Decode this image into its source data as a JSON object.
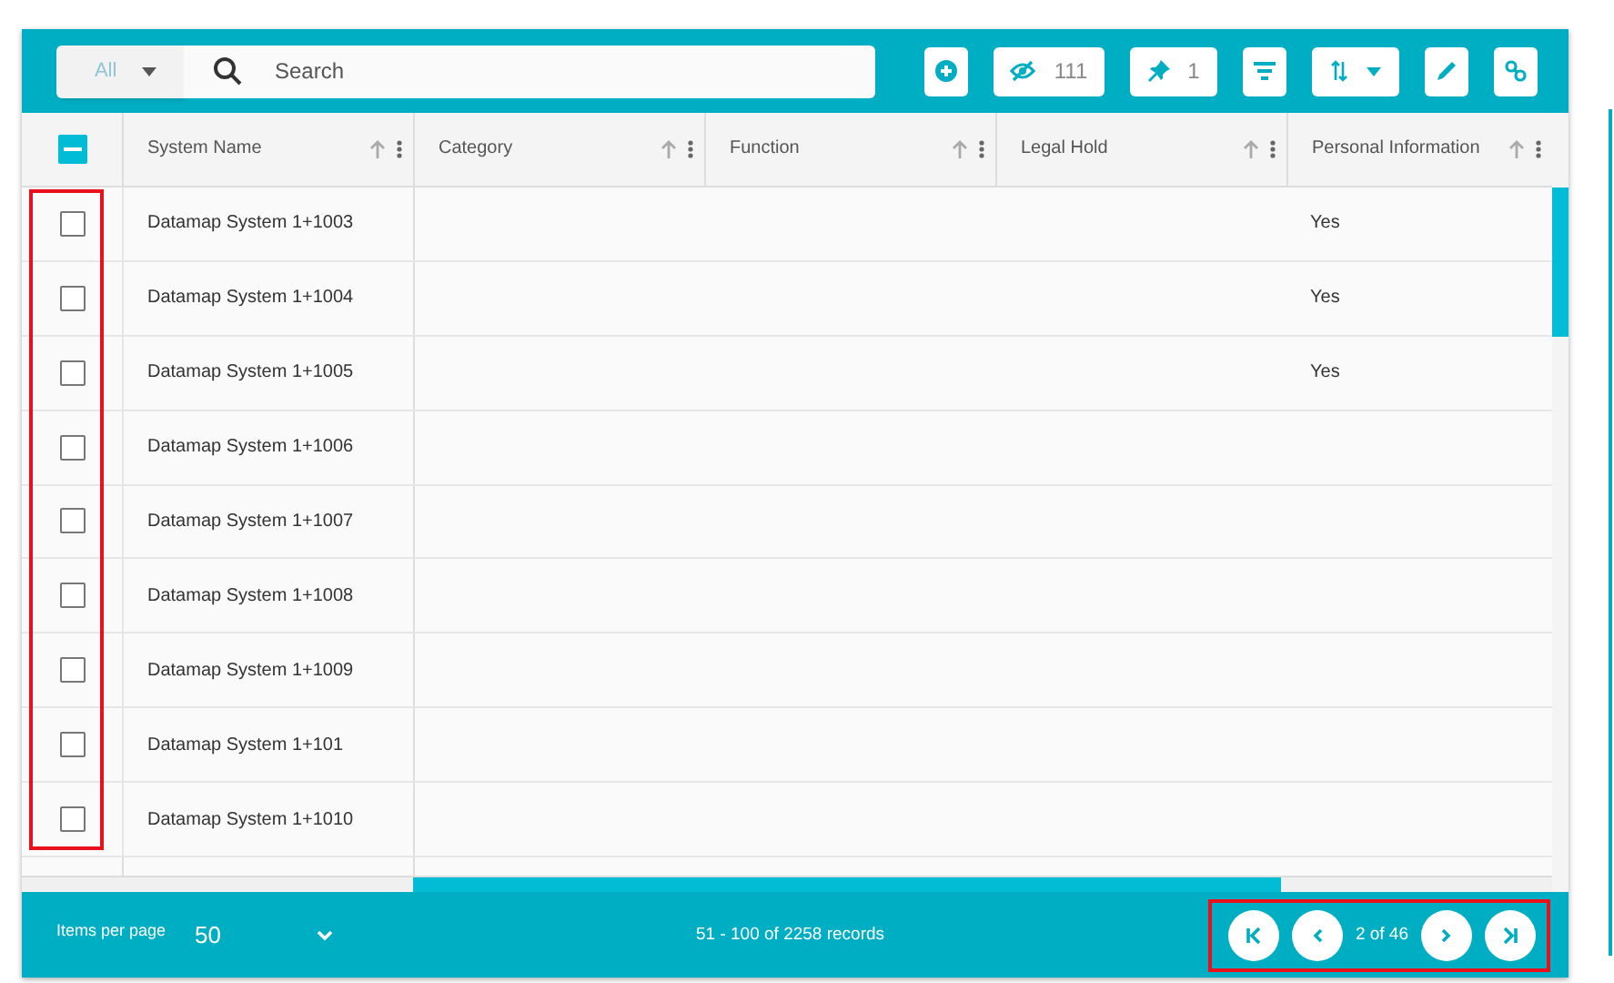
{
  "toolbar": {
    "scope": "All",
    "search_placeholder": "Search",
    "hidden_count": "111",
    "pinned_count": "1"
  },
  "table": {
    "select_all_indeterminate": true,
    "columns": [
      {
        "label": "System Name"
      },
      {
        "label": "Category"
      },
      {
        "label": "Function"
      },
      {
        "label": "Legal Hold"
      },
      {
        "label": "Personal Information"
      }
    ],
    "rows": [
      {
        "checked": false,
        "cells": [
          "Datamap System 1+1003",
          "",
          "",
          "",
          "Yes"
        ]
      },
      {
        "checked": false,
        "cells": [
          "Datamap System 1+1004",
          "",
          "",
          "",
          "Yes"
        ]
      },
      {
        "checked": false,
        "cells": [
          "Datamap System 1+1005",
          "",
          "",
          "",
          "Yes"
        ]
      },
      {
        "checked": false,
        "cells": [
          "Datamap System 1+1006",
          "",
          "",
          "",
          ""
        ]
      },
      {
        "checked": false,
        "cells": [
          "Datamap System 1+1007",
          "",
          "",
          "",
          ""
        ]
      },
      {
        "checked": false,
        "cells": [
          "Datamap System 1+1008",
          "",
          "",
          "",
          ""
        ]
      },
      {
        "checked": false,
        "cells": [
          "Datamap System 1+1009",
          "",
          "",
          "",
          ""
        ]
      },
      {
        "checked": false,
        "cells": [
          "Datamap System 1+101",
          "",
          "",
          "",
          ""
        ]
      },
      {
        "checked": false,
        "cells": [
          "Datamap System 1+1010",
          "",
          "",
          "",
          ""
        ]
      }
    ]
  },
  "footer": {
    "items_per_page_label": "Items per page",
    "items_per_page": "50",
    "records": "51 - 100 of 2258 records",
    "page": "2 of 46"
  }
}
